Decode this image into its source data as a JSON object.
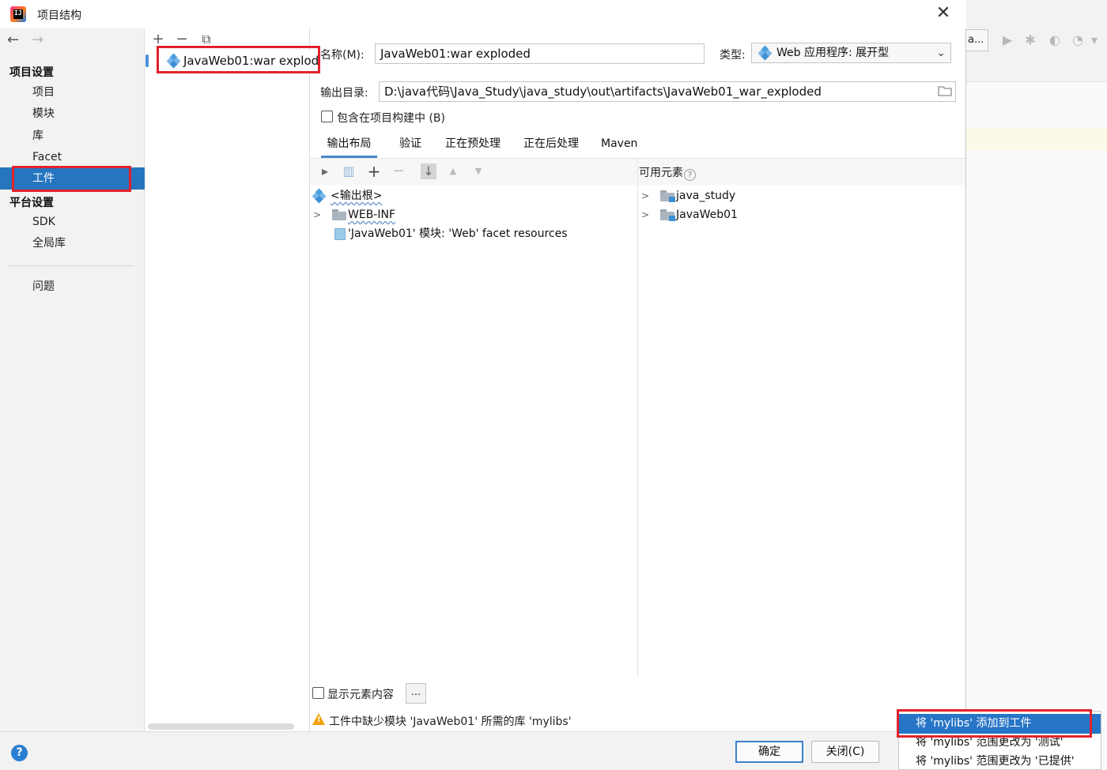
{
  "window": {
    "title": "项目结构",
    "app_icon_text": "IJ",
    "close_icon": "✕"
  },
  "nav": {
    "back_icon": "←",
    "forward_icon": "→",
    "section_project": "项目设置",
    "items_project": [
      "项目",
      "模块",
      "库",
      "Facet",
      "工件"
    ],
    "section_platform": "平台设置",
    "items_platform": [
      "SDK",
      "全局库"
    ],
    "problems": "问题",
    "selected": "工件"
  },
  "artifacts": {
    "toolbar": {
      "add": "+",
      "remove": "−",
      "copy": "⧉"
    },
    "items": [
      "JavaWeb01:war explod"
    ]
  },
  "form": {
    "name_label": "名称(M):",
    "name_value": "JavaWeb01:war exploded",
    "type_label": "类型:",
    "type_value": "Web 应用程序: 展开型",
    "output_label": "输出目录:",
    "output_value": "D:\\java代码\\Java_Study\\java_study\\out\\artifacts\\JavaWeb01_war_exploded",
    "include_in_build_label": "包含在项目构建中 (B)",
    "include_in_build_checked": false
  },
  "tabs": {
    "items": [
      "输出布局",
      "验证",
      "正在预处理",
      "正在后处理",
      "Maven"
    ],
    "active": "输出布局"
  },
  "layout": {
    "toolbar": {
      "new_dir": "▸",
      "archive": "▥",
      "add": "+",
      "remove": "−",
      "sort": "↓",
      "up": "▲",
      "down": "▼"
    },
    "tree": {
      "root": "<输出根>",
      "web_inf": "WEB-INF",
      "facet_resources": "'JavaWeb01' 模块: 'Web' facet resources"
    },
    "available_label": "可用元素",
    "available_help": "?",
    "available_items": [
      "java_study",
      "JavaWeb01"
    ]
  },
  "bottom": {
    "show_content_label": "显示元素内容",
    "show_content_checked": false,
    "ellipsis": "...",
    "warning": "工件中缺少模块 'JavaWeb01' 所需的库 'mylibs'",
    "warning_mark": "!"
  },
  "footer": {
    "help": "?",
    "ok": "确定",
    "close": "关闭(C)"
  },
  "popup": {
    "items": [
      "将 'mylibs' 添加到工件",
      "将 'mylibs' 范围更改为 '测试'",
      "将 'mylibs' 范围更改为 '已提供'"
    ],
    "highlighted": "将 'mylibs' 添加到工件"
  },
  "background_ide": {
    "button_text": "a...",
    "toolbar_icons": [
      "▶",
      "✱",
      "◐",
      "◔",
      "▾"
    ]
  },
  "colors": {
    "selection_blue": "#2675bf",
    "highlight_red_box": "#e3212b",
    "warning_orange": "#f2a20a"
  }
}
